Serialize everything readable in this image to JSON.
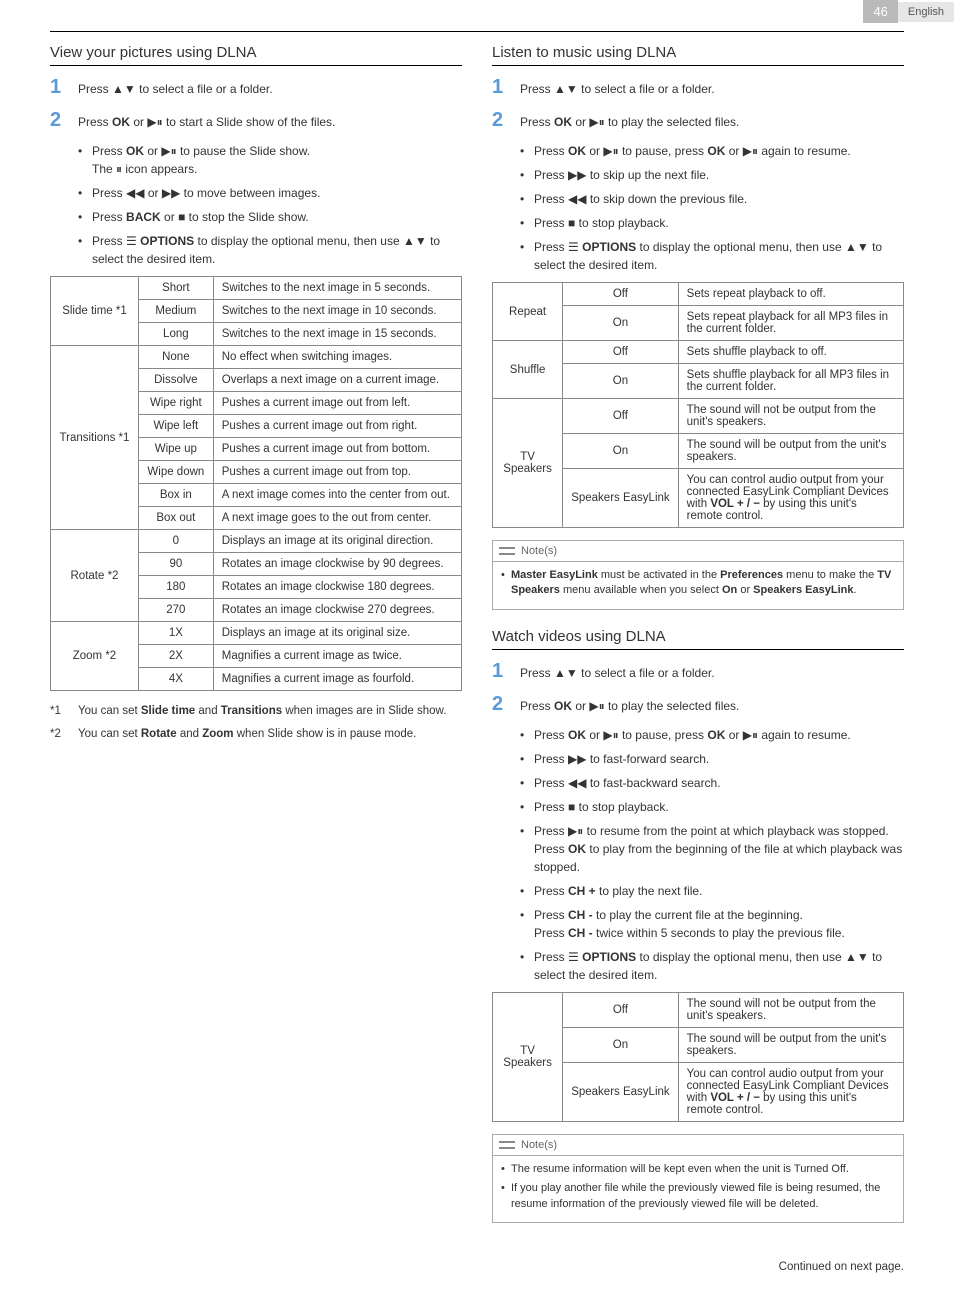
{
  "header": {
    "page": "46",
    "lang": "English"
  },
  "left": {
    "pictures": {
      "title": "View your pictures using DLNA",
      "step1": "to select a file or a folder.",
      "step2": "to start a Slide show of the files.",
      "bullets": {
        "b1a": "to pause the Slide show.",
        "b1b": "icon appears.",
        "b2": "to move between images.",
        "b3": "to stop the Slide show.",
        "b4a": "to display the optional menu, then use",
        "b4b": "to select the desired item."
      },
      "table": {
        "slide_time": {
          "label": "Slide time *1",
          "short": {
            "k": "Short",
            "v": "Switches to the next image in 5 seconds."
          },
          "medium": {
            "k": "Medium",
            "v": "Switches to the next image in 10 seconds."
          },
          "long": {
            "k": "Long",
            "v": "Switches to the next image in 15 seconds."
          }
        },
        "transitions": {
          "label": "Transitions *1",
          "none": {
            "k": "None",
            "v": "No effect when switching images."
          },
          "dissolve": {
            "k": "Dissolve",
            "v": "Overlaps a next image on a current image."
          },
          "wipe_right": {
            "k": "Wipe right",
            "v": "Pushes a current image out from left."
          },
          "wipe_left": {
            "k": "Wipe left",
            "v": "Pushes a current image out from right."
          },
          "wipe_up": {
            "k": "Wipe up",
            "v": "Pushes a current image out from bottom."
          },
          "wipe_down": {
            "k": "Wipe down",
            "v": "Pushes a current image out from top."
          },
          "box_in": {
            "k": "Box in",
            "v": "A next image comes into the center from out."
          },
          "box_out": {
            "k": "Box out",
            "v": "A next image goes to the out from center."
          }
        },
        "rotate": {
          "label": "Rotate *2",
          "r0": {
            "k": "0",
            "v": "Displays an image at its original direction."
          },
          "r90": {
            "k": "90",
            "v": "Rotates an image clockwise by 90 degrees."
          },
          "r180": {
            "k": "180",
            "v": "Rotates an image clockwise 180 degrees."
          },
          "r270": {
            "k": "270",
            "v": "Rotates an image clockwise 270 degrees."
          }
        },
        "zoom": {
          "label": "Zoom *2",
          "z1": {
            "k": "1X",
            "v": "Displays an image at its original size."
          },
          "z2": {
            "k": "2X",
            "v": "Magnifies a current image as twice."
          },
          "z4": {
            "k": "4X",
            "v": "Magnifies a current image as fourfold."
          }
        }
      },
      "footnotes": {
        "f1": {
          "k": "*1",
          "pre": "You can set ",
          "b1": "Slide time",
          "mid": " and ",
          "b2": "Transitions",
          "post": " when images are in Slide show."
        },
        "f2": {
          "k": "*2",
          "pre": "You can set ",
          "b1": "Rotate",
          "mid": " and ",
          "b2": "Zoom",
          "post": " when Slide show is in pause mode."
        }
      }
    }
  },
  "right": {
    "music": {
      "title": "Listen to music using DLNA",
      "step1": "to select a file or a folder.",
      "step2": "to play the selected files.",
      "bullets": {
        "b1": {
          "mid": "to pause, press",
          "end": "again to resume."
        },
        "b2": "to skip up the next file.",
        "b3": "to skip down the previous file.",
        "b4": "to stop playback.",
        "b5a": "to display the optional menu, then use",
        "b5b": "to select the desired item."
      },
      "table": {
        "repeat": {
          "label": "Repeat",
          "off": {
            "k": "Off",
            "v": "Sets repeat playback to off."
          },
          "on": {
            "k": "On",
            "v": "Sets repeat playback for all MP3 files in the current folder."
          }
        },
        "shuffle": {
          "label": "Shuffle",
          "off": {
            "k": "Off",
            "v": "Sets shuffle playback to off."
          },
          "on": {
            "k": "On",
            "v": "Sets shuffle playback for all MP3 files in the current folder."
          }
        },
        "tv": {
          "label": "TV Speakers",
          "off": {
            "k": "Off",
            "v": "The sound will not be output from the unit's speakers."
          },
          "on": {
            "k": "On",
            "v": "The sound will be output from the unit's speakers."
          },
          "easy": {
            "k": "Speakers EasyLink",
            "v1": "You can control audio output from your connected EasyLink Compliant Devices with ",
            "vb": "VOL + / −",
            "v2": " by using this unit's remote control."
          }
        }
      },
      "note": {
        "head": "Note(s)",
        "t1": "Master EasyLink",
        "t2": " must be activated in the ",
        "t3": "Preferences",
        "t4": " menu to make the ",
        "t5": "TV Speakers",
        "t6": " menu available when you select ",
        "t7": "On",
        "t8": " or ",
        "t9": "Speakers EasyLink",
        "t10": "."
      }
    },
    "video": {
      "title": "Watch videos using DLNA",
      "step1": "to select a file or a folder.",
      "step2": "to play the selected files.",
      "bullets": {
        "b1": {
          "mid": "to pause, press",
          "end": "again to resume."
        },
        "b2": "to fast-forward search.",
        "b3": "to fast-backward search.",
        "b4": "to stop playback.",
        "b5a": "to resume from the point at which playback was stopped. Press",
        "b5b": "to play from the beginning of the file at which playback was stopped.",
        "b6": {
          "pre": "Press ",
          "b": "CH +",
          "post": " to play the next file."
        },
        "b7": {
          "pre1": "Press ",
          "b1": "CH -",
          "mid1": " to play the current file at the beginning.",
          "pre2": "Press ",
          "b2": "CH -",
          "mid2": " twice within 5 seconds to play the previous file."
        },
        "b8a": "to display the optional menu, then use",
        "b8b": "to select the desired item."
      },
      "table": {
        "tv": {
          "label": "TV Speakers",
          "off": {
            "k": "Off",
            "v": "The sound will not be output from the unit's speakers."
          },
          "on": {
            "k": "On",
            "v": "The sound will be output from the unit's speakers."
          },
          "easy": {
            "k": "Speakers EasyLink",
            "v1": "You can control audio output from your connected EasyLink Compliant Devices with ",
            "vb": "VOL + / −",
            "v2": " by using this unit's remote control."
          }
        }
      },
      "note": {
        "head": "Note(s)",
        "n1": "The resume information will be kept even when the unit is Turned Off.",
        "n2": "If you play another file while the previously viewed file is being resumed, the resume information of the previously viewed file will be deleted."
      }
    }
  },
  "labels": {
    "press": "Press",
    "the": "The",
    "ok": "OK",
    "or": "or",
    "back": "BACK",
    "options": "OPTIONS"
  },
  "footer": {
    "continued": "Continued on next page."
  }
}
